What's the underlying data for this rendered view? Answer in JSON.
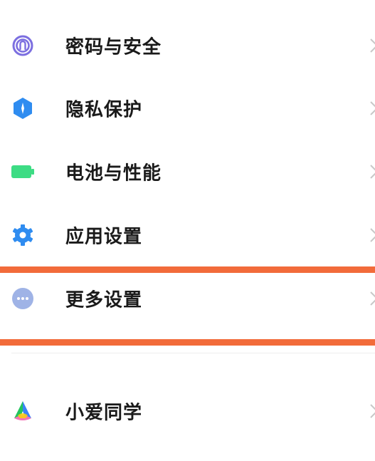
{
  "settings": {
    "items": [
      {
        "label": "密码与安全",
        "icon": "fingerprint-icon",
        "color": "#7c6fe0"
      },
      {
        "label": "隐私保护",
        "icon": "privacy-shield-icon",
        "color": "#2f8cf0"
      },
      {
        "label": "电池与性能",
        "icon": "battery-icon",
        "color": "#3ddc84"
      },
      {
        "label": "应用设置",
        "icon": "gear-icon",
        "color": "#2f8cf0"
      },
      {
        "label": "更多设置",
        "icon": "more-icon",
        "color": "#9fb3e6"
      },
      {
        "label": "小爱同学",
        "icon": "xiaoai-icon",
        "color": "#3b82f6"
      }
    ]
  },
  "highlight_color": "#f26b3a"
}
